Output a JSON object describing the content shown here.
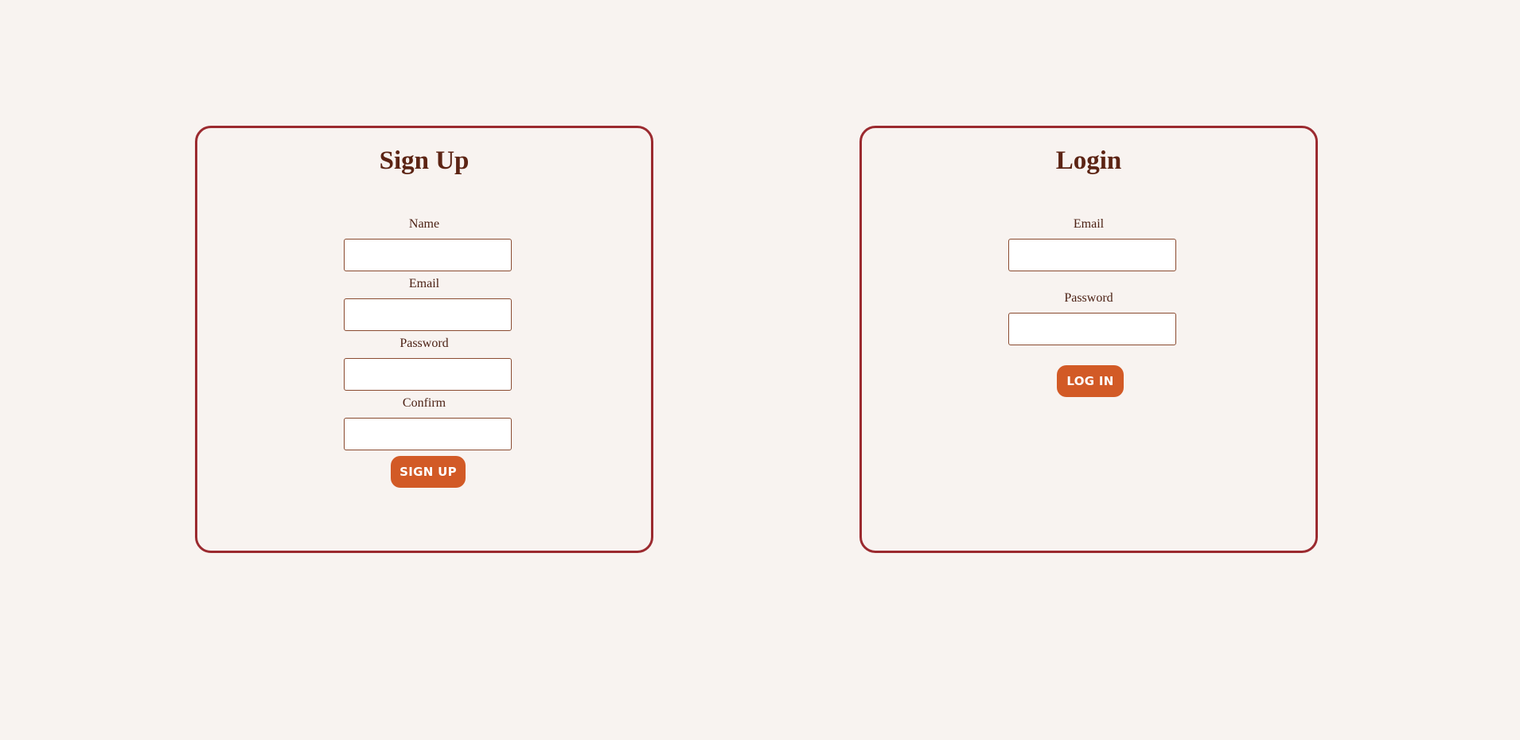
{
  "colors": {
    "background": "#f8f3f0",
    "card_border": "#9b2a2f",
    "title_text": "#5c2414",
    "label_text": "#4a1f12",
    "input_border": "#8a4b30",
    "button_bg": "#d25a26",
    "button_text": "#ffffff"
  },
  "signup": {
    "title": "Sign Up",
    "fields": [
      {
        "label": "Name",
        "value": "",
        "placeholder": ""
      },
      {
        "label": "Email",
        "value": "",
        "placeholder": ""
      },
      {
        "label": "Password",
        "value": "",
        "placeholder": ""
      },
      {
        "label": "Confirm",
        "value": "",
        "placeholder": ""
      }
    ],
    "button_label": "SIGN UP"
  },
  "login": {
    "title": "Login",
    "fields": [
      {
        "label": "Email",
        "value": "",
        "placeholder": ""
      },
      {
        "label": "Password",
        "value": "",
        "placeholder": ""
      }
    ],
    "button_label": "LOG IN"
  }
}
